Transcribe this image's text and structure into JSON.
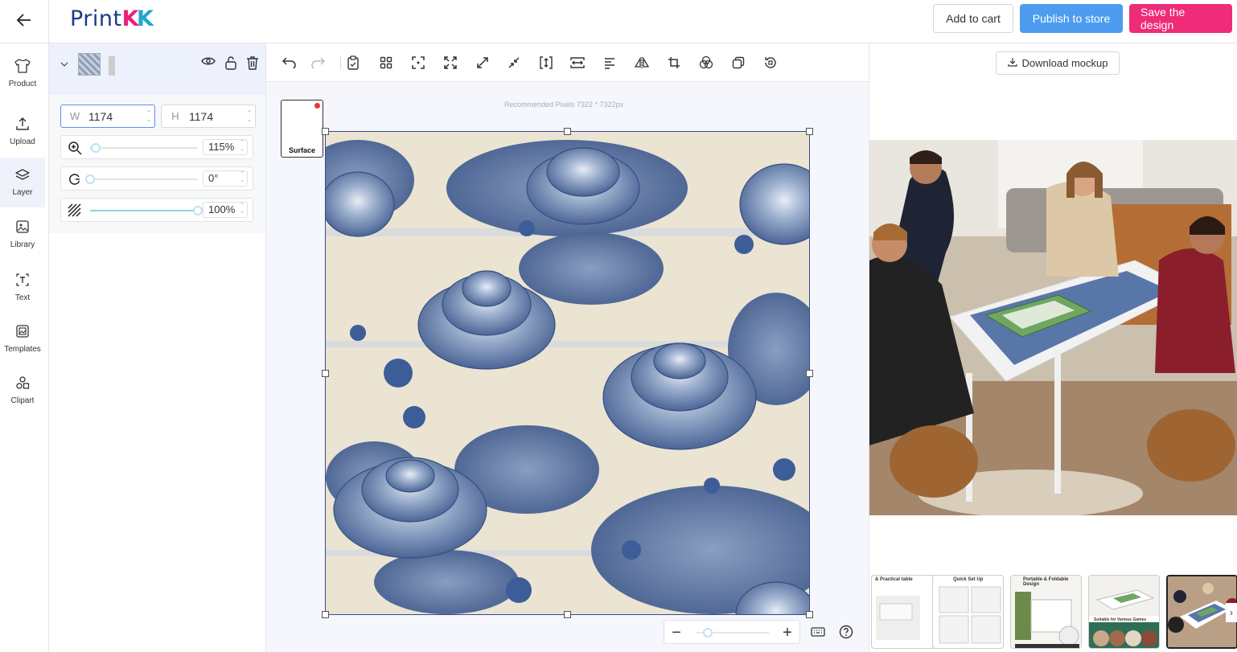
{
  "brand": {
    "logo_main": "Print",
    "logo_k1": "K",
    "logo_k2": "K"
  },
  "header": {
    "add_to_cart": "Add to cart",
    "publish": "Publish to store",
    "save": "Save the design"
  },
  "nav": {
    "items": [
      {
        "label": "Product",
        "icon": "shirt-icon"
      },
      {
        "label": "Upload",
        "icon": "upload-icon"
      },
      {
        "label": "Layer",
        "icon": "layers-icon"
      },
      {
        "label": "Library",
        "icon": "image-icon"
      },
      {
        "label": "Text",
        "icon": "text-icon"
      },
      {
        "label": "Templates",
        "icon": "templates-icon"
      },
      {
        "label": "Clipart",
        "icon": "shapes-icon"
      }
    ],
    "active": "Layer"
  },
  "layer_panel": {
    "width_label": "W",
    "width_value": "1174",
    "height_label": "H",
    "height_value": "1174",
    "zoom_value": "115%",
    "rotation_value": "0°",
    "opacity_value": "100%",
    "zoom_level": 0.05,
    "rotation_level": 0.0,
    "opacity_level": 1.0
  },
  "canvas": {
    "recommended_text": "Recommended Pixels 7322 * 7322px",
    "surface_label": "Surface",
    "canvas_zoom_level": 0.15
  },
  "preview": {
    "download_label": "Download mockup",
    "thumbnails": [
      {
        "caption": "& Practical table"
      },
      {
        "caption": "Quick Set Up"
      },
      {
        "caption": "Portable & Foldable Design"
      },
      {
        "caption": "Suitable for Various Games"
      },
      {
        "caption": ""
      }
    ]
  },
  "colors": {
    "accent_blue": "#4d9cf0",
    "accent_pink": "#ef2c78",
    "brand_navy": "#1d3a8a"
  }
}
